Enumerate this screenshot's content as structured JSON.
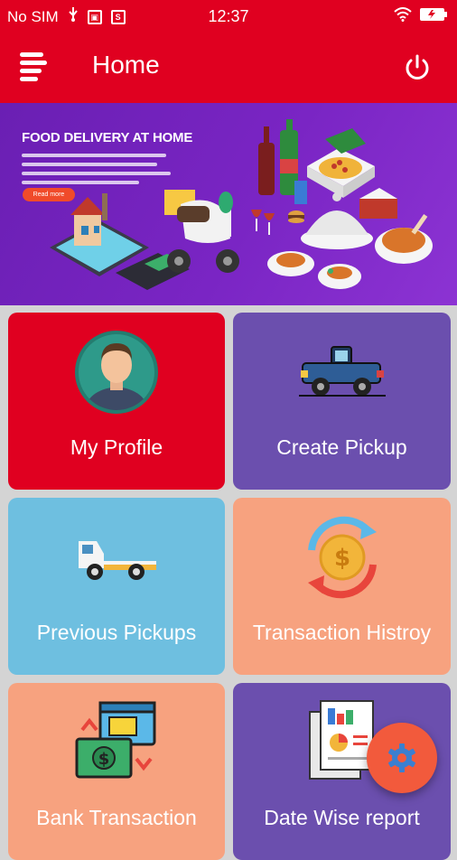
{
  "status_bar": {
    "carrier": "No SIM",
    "time": "12:37"
  },
  "header": {
    "title": "Home"
  },
  "banner": {
    "title": "FOOD DELIVERY AT HOME",
    "button_label": "Read more"
  },
  "tiles": [
    {
      "label": "My Profile",
      "color": "#e00020",
      "icon": "user-avatar-icon"
    },
    {
      "label": "Create Pickup",
      "color": "#6b4fae",
      "icon": "pickup-truck-icon"
    },
    {
      "label": "Previous Pickups",
      "color": "#6ebfe0",
      "icon": "delivery-truck-icon"
    },
    {
      "label": "Transaction Histroy",
      "color": "#f7a27f",
      "icon": "dollar-exchange-icon"
    },
    {
      "label": "Bank Transaction",
      "color": "#f7a27f",
      "icon": "bank-transfer-icon"
    },
    {
      "label": "Date Wise report",
      "color": "#6b4fae",
      "icon": "report-document-icon"
    }
  ],
  "fab": {
    "icon": "settings-gear-icon",
    "color": "#f25a3c"
  }
}
